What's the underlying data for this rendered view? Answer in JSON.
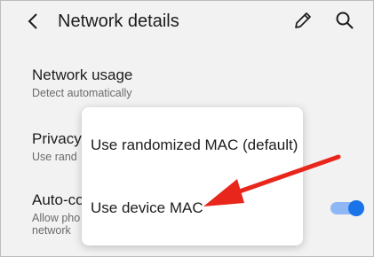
{
  "header": {
    "title": "Network details",
    "back_icon": "back-arrow-icon",
    "edit_icon": "pencil-icon",
    "search_icon": "search-icon"
  },
  "settings": {
    "network_usage": {
      "title": "Network usage",
      "subtitle": "Detect automatically"
    },
    "privacy": {
      "title": "Privacy",
      "subtitle": "Use rand"
    },
    "auto_connect": {
      "title": "Auto-co",
      "subtitle_line1": "Allow pho",
      "subtitle_line2": "network",
      "toggle_on": true
    }
  },
  "mac_menu": {
    "options": [
      {
        "label": "Use randomized MAC (default)"
      },
      {
        "label": "Use device MAC"
      }
    ]
  },
  "annotation": {
    "arrow_color": "#e8261c",
    "points_to": "Use device MAC"
  },
  "colors": {
    "background": "#f2f2f2",
    "accent": "#1a73e8",
    "text": "#1c1c1c",
    "secondary_text": "#6b6b6b"
  }
}
